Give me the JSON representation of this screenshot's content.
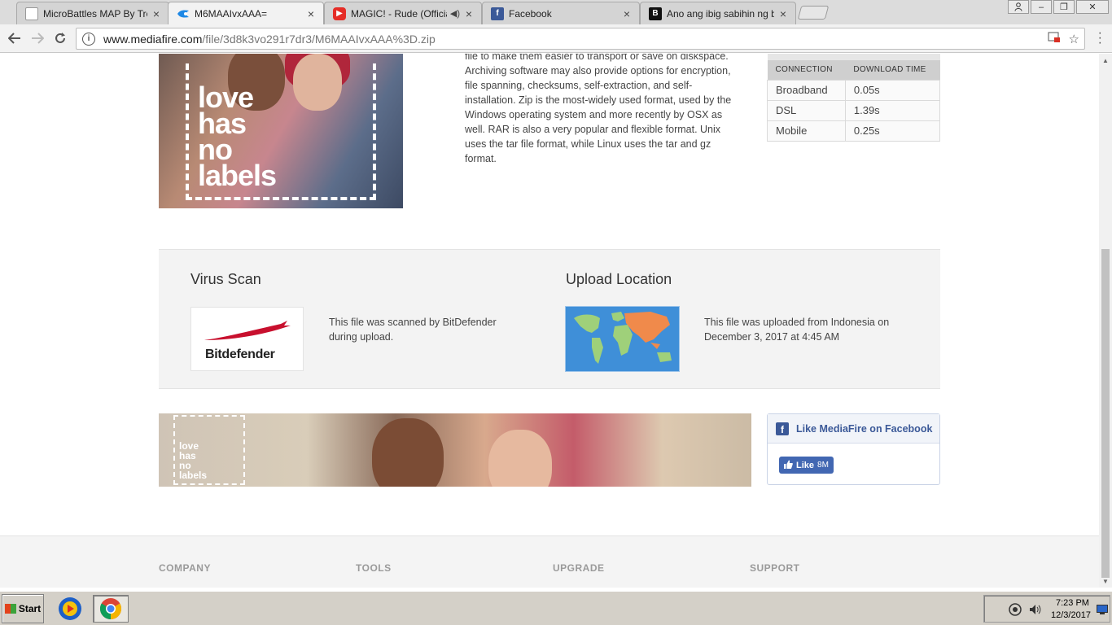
{
  "browser": {
    "tabs": [
      {
        "title": "MicroBattles MAP By Trenzk",
        "favicon": "document-icon",
        "active": false
      },
      {
        "title": "M6MAAIvxAAA=",
        "favicon": "mediafire-icon",
        "active": true
      },
      {
        "title": "MAGIC! - Rude (Official",
        "favicon": "youtube-icon",
        "active": false
      },
      {
        "title": "Facebook",
        "favicon": "facebook-icon",
        "active": false
      },
      {
        "title": "Ano ang ibig sabihin ng bala",
        "favicon": "brainly-icon",
        "active": false
      }
    ],
    "address": {
      "host": "www.mediafire.com",
      "path": "/file/3d8k3vo291r7dr3/M6MAAIvxAAA%3D.zip"
    }
  },
  "page": {
    "hero": {
      "logo_text": [
        "love",
        "has",
        "no",
        "labels"
      ]
    },
    "description": "file to make them easier to transport or save on diskspace. Archiving software may also provide options for encryption, file spanning, checksums, self-extraction, and self-installation. Zip is the most-widely used format, used by the Windows operating system and more recently by OSX as well. RAR is also a very popular and flexible format. Unix uses the tar file format, while Linux uses the tar and gz format.",
    "download_table": {
      "headers": [
        "CONNECTION",
        "DOWNLOAD TIME"
      ],
      "rows": [
        [
          "Broadband",
          "0.05s"
        ],
        [
          "DSL",
          "1.39s"
        ],
        [
          "Mobile",
          "0.25s"
        ]
      ]
    },
    "virus_scan": {
      "title": "Virus Scan",
      "logo": "Bitdefender",
      "text": "This file was scanned by BitDefender during upload."
    },
    "upload_location": {
      "title": "Upload Location",
      "text": "This file was uploaded from Indonesia on December 3, 2017 at 4:45 AM"
    },
    "banner": {
      "logo_text": [
        "love",
        "has",
        "no",
        "labels"
      ]
    },
    "facebook": {
      "title": "Like MediaFire on Facebook",
      "like_label": "Like",
      "like_count": "8M"
    },
    "footer": {
      "columns": [
        "COMPANY",
        "TOOLS",
        "UPGRADE",
        "SUPPORT"
      ]
    }
  },
  "taskbar": {
    "start_label": "Start",
    "time": "7:23 PM",
    "date": "12/3/2017"
  },
  "colors": {
    "facebook_blue": "#3b5998",
    "map_ocean": "#3f8fd8",
    "map_land": "#9fd07a",
    "map_highlight": "#f08a4b",
    "bitdefender_red": "#c8102e"
  }
}
